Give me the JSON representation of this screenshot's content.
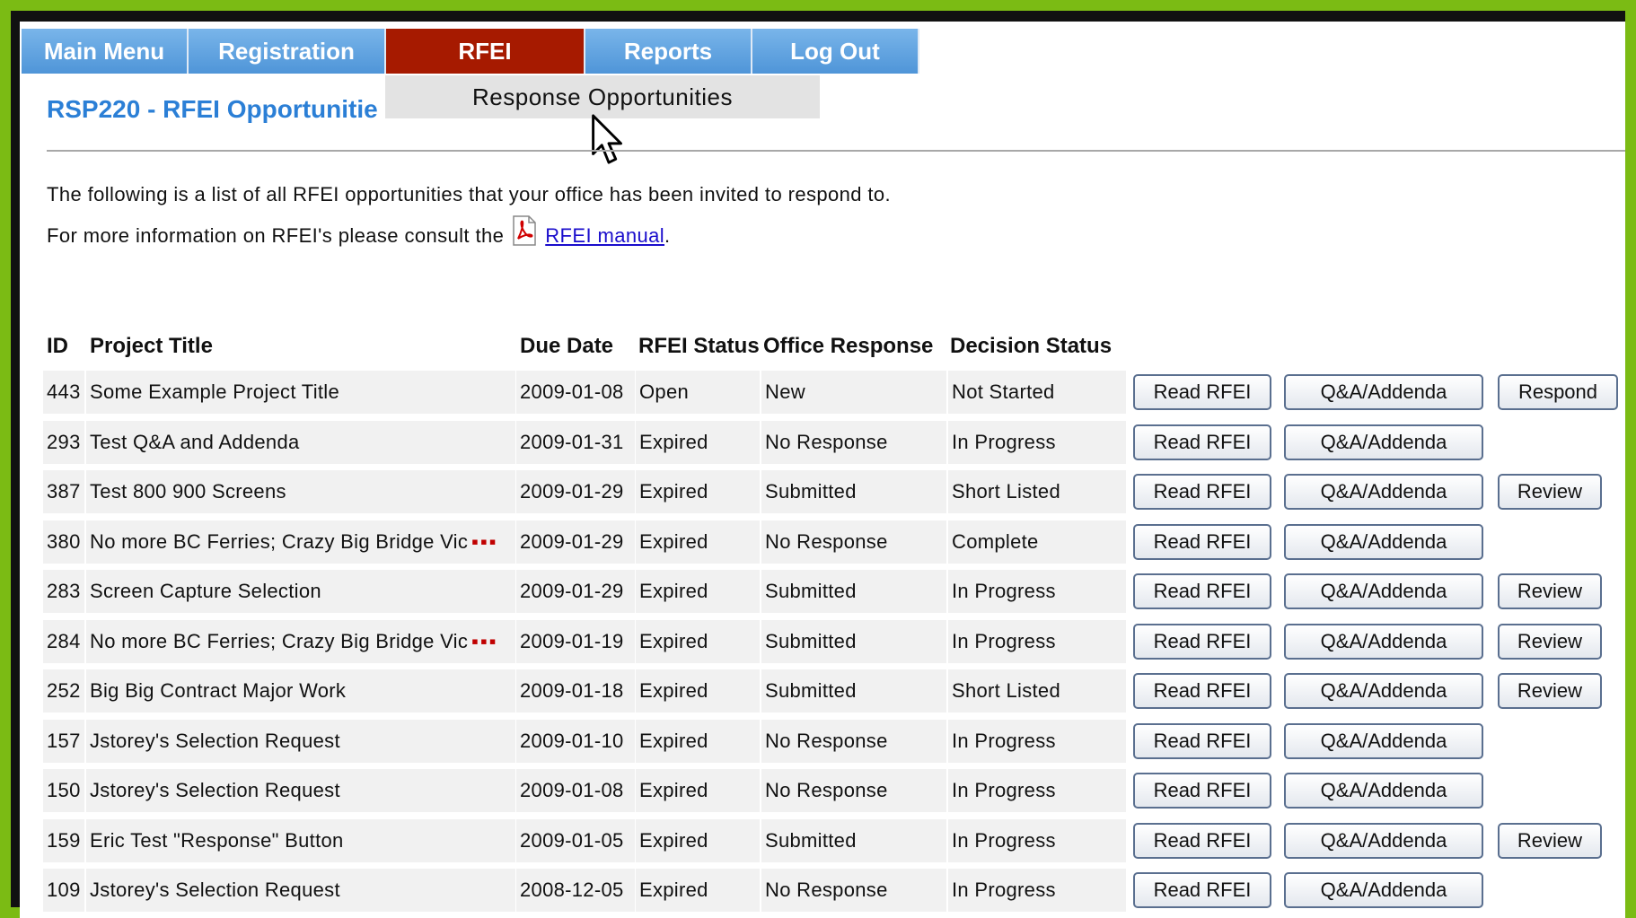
{
  "nav": {
    "items": [
      {
        "label": "Main Menu",
        "active": false
      },
      {
        "label": "Registration",
        "active": false
      },
      {
        "label": "RFEI",
        "active": true
      },
      {
        "label": "Reports",
        "active": false
      },
      {
        "label": "Log Out",
        "active": false
      }
    ],
    "dropdown_item": "Response Opportunities"
  },
  "page": {
    "title": "RSP220 - RFEI Opportunitie",
    "intro_line1": "The following is a list of all RFEI opportunities that your office has been invited to respond to.",
    "intro_line2_prefix": "For more information on RFEI's please consult the",
    "manual_link": "RFEI manual",
    "intro_line2_suffix": "."
  },
  "table": {
    "headers": {
      "id": "ID",
      "title": "Project Title",
      "due": "Due Date",
      "rfei_status": "RFEI Status",
      "office_response": "Office Response",
      "decision_status": "Decision Status"
    },
    "buttons": {
      "read": "Read RFEI",
      "qa": "Q&A/Addenda",
      "respond": "Respond",
      "review": "Review"
    },
    "rows": [
      {
        "id": "443",
        "title": "Some Example Project Title",
        "truncated": false,
        "due": "2009-01-08",
        "status": "Open",
        "response": "New",
        "decision": "Not Started",
        "action": "respond"
      },
      {
        "id": "293",
        "title": "Test Q&A and Addenda",
        "truncated": false,
        "due": "2009-01-31",
        "status": "Expired",
        "response": "No Response",
        "decision": "In Progress",
        "action": ""
      },
      {
        "id": "387",
        "title": "Test 800 900 Screens",
        "truncated": false,
        "due": "2009-01-29",
        "status": "Expired",
        "response": "Submitted",
        "decision": "Short Listed",
        "action": "review"
      },
      {
        "id": "380",
        "title": "No more BC Ferries; Crazy Big Bridge Vic",
        "truncated": true,
        "due": "2009-01-29",
        "status": "Expired",
        "response": "No Response",
        "decision": "Complete",
        "action": ""
      },
      {
        "id": "283",
        "title": "Screen Capture Selection",
        "truncated": false,
        "due": "2009-01-29",
        "status": "Expired",
        "response": "Submitted",
        "decision": "In Progress",
        "action": "review"
      },
      {
        "id": "284",
        "title": "No more BC Ferries; Crazy Big Bridge Vic",
        "truncated": true,
        "due": "2009-01-19",
        "status": "Expired",
        "response": "Submitted",
        "decision": "In Progress",
        "action": "review"
      },
      {
        "id": "252",
        "title": "Big Big Contract Major Work",
        "truncated": false,
        "due": "2009-01-18",
        "status": "Expired",
        "response": "Submitted",
        "decision": "Short Listed",
        "action": "review"
      },
      {
        "id": "157",
        "title": "Jstorey's Selection Request",
        "truncated": false,
        "due": "2009-01-10",
        "status": "Expired",
        "response": "No Response",
        "decision": "In Progress",
        "action": ""
      },
      {
        "id": "150",
        "title": "Jstorey's Selection Request",
        "truncated": false,
        "due": "2009-01-08",
        "status": "Expired",
        "response": "No Response",
        "decision": "In Progress",
        "action": ""
      },
      {
        "id": "159",
        "title": "Eric Test \"Response\" Button",
        "truncated": false,
        "due": "2009-01-05",
        "status": "Expired",
        "response": "Submitted",
        "decision": "In Progress",
        "action": "review"
      },
      {
        "id": "109",
        "title": "Jstorey's Selection Request",
        "truncated": false,
        "due": "2008-12-05",
        "status": "Expired",
        "response": "No Response",
        "decision": "In Progress",
        "action": ""
      }
    ]
  },
  "colors": {
    "nav_blue": "#5a9fe0",
    "nav_active": "#a61a00",
    "title_blue": "#2b7fd6",
    "frame_green": "#7bbb14"
  }
}
